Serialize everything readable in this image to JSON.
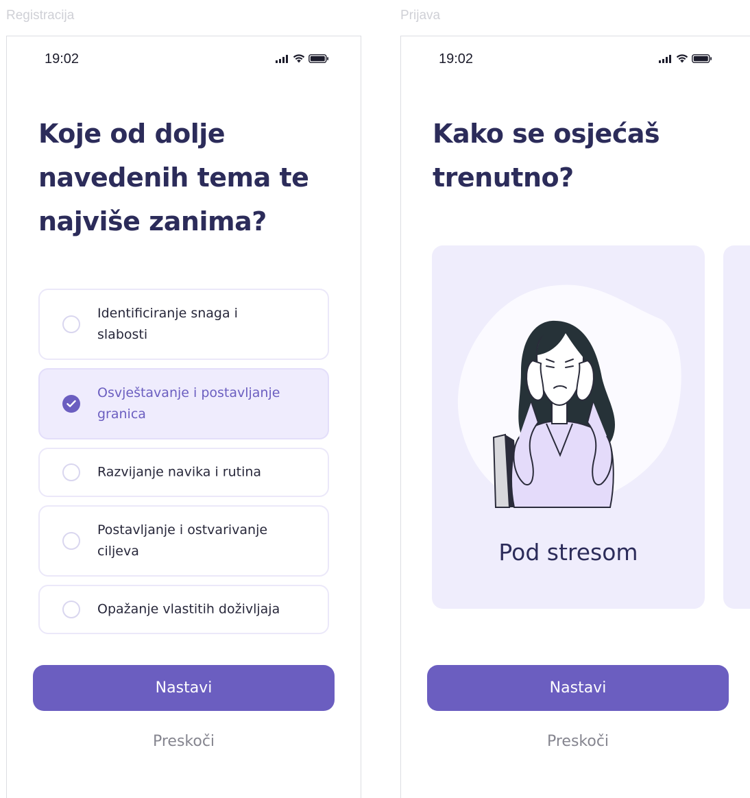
{
  "frames": {
    "registration": {
      "label": "Registracija",
      "status_time": "19:02",
      "title_lines": [
        "Koje od dolje",
        "navedenih tema te",
        "najviše zanima?"
      ],
      "options": [
        {
          "line1": "Identificiranje snaga i",
          "line2": "slabosti",
          "selected": false
        },
        {
          "line1": "Osvještavanje i postavljanje",
          "line2": "granica",
          "selected": true
        },
        {
          "line1": "Razvijanje navika i rutina",
          "line2": "",
          "selected": false
        },
        {
          "line1": "Postavljanje i ostvarivanje",
          "line2": "ciljeva",
          "selected": false
        },
        {
          "line1": "Opažanje vlastitih doživljaja",
          "line2": "",
          "selected": false
        }
      ],
      "continue_label": "Nastavi",
      "skip_label": "Preskoči"
    },
    "login": {
      "label": "Prijava",
      "status_time": "19:02",
      "title_lines": [
        "Kako se osjećaš",
        "trenutno?"
      ],
      "mood_card": {
        "label": "Pod stresom",
        "illustration": "stressed-woman-illustration"
      },
      "continue_label": "Nastavi",
      "skip_label": "Preskoči"
    }
  },
  "colors": {
    "accent": "#6b5ec0",
    "card_bg": "#efedfc",
    "title": "#2c2c5a",
    "muted": "#85858f"
  },
  "icons": [
    "signal-icon",
    "wifi-icon",
    "battery-icon",
    "check-icon"
  ]
}
